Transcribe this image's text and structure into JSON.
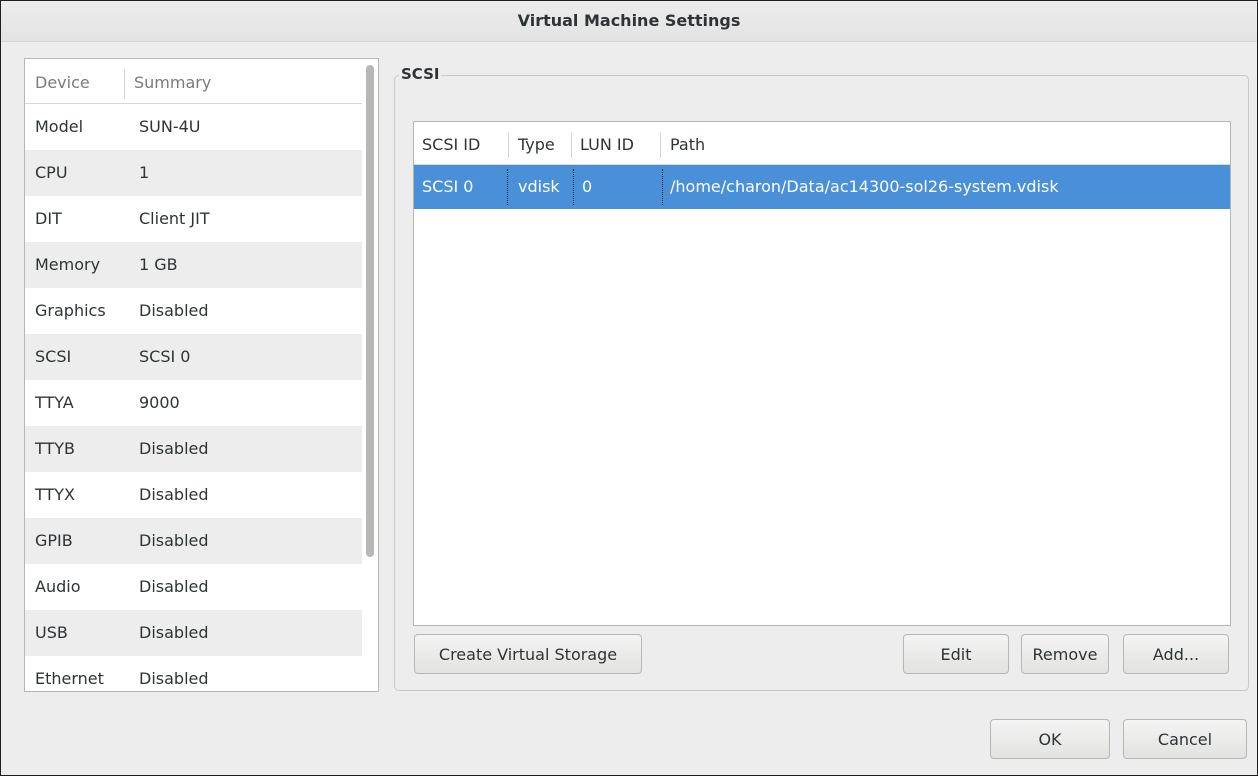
{
  "window": {
    "title": "Virtual Machine Settings"
  },
  "device_list": {
    "columns": {
      "device": "Device",
      "summary": "Summary"
    },
    "rows": [
      {
        "device": "Model",
        "summary": "SUN-4U"
      },
      {
        "device": "CPU",
        "summary": "1"
      },
      {
        "device": "DIT",
        "summary": "Client JIT"
      },
      {
        "device": "Memory",
        "summary": "1 GB"
      },
      {
        "device": "Graphics",
        "summary": "Disabled"
      },
      {
        "device": "SCSI",
        "summary": "SCSI 0"
      },
      {
        "device": "TTYA",
        "summary": "9000"
      },
      {
        "device": "TTYB",
        "summary": "Disabled"
      },
      {
        "device": "TTYX",
        "summary": "Disabled"
      },
      {
        "device": "GPIB",
        "summary": "Disabled"
      },
      {
        "device": "Audio",
        "summary": "Disabled"
      },
      {
        "device": "USB",
        "summary": "Disabled"
      },
      {
        "device": "Ethernet",
        "summary": "Disabled"
      }
    ]
  },
  "scsi": {
    "group_label": "SCSI",
    "columns": {
      "id": "SCSI ID",
      "type": "Type",
      "lun": "LUN ID",
      "path": "Path"
    },
    "rows": [
      {
        "id": "SCSI 0",
        "type": "vdisk",
        "lun": "0",
        "path": "/home/charon/Data/ac14300-sol26-system.vdisk",
        "selected": true
      }
    ],
    "buttons": {
      "create": "Create Virtual Storage",
      "edit": "Edit",
      "remove": "Remove",
      "add": "Add..."
    }
  },
  "dialog_buttons": {
    "ok": "OK",
    "cancel": "Cancel"
  },
  "colors": {
    "selection": "#4a90d9",
    "window_bg": "#ededed"
  }
}
